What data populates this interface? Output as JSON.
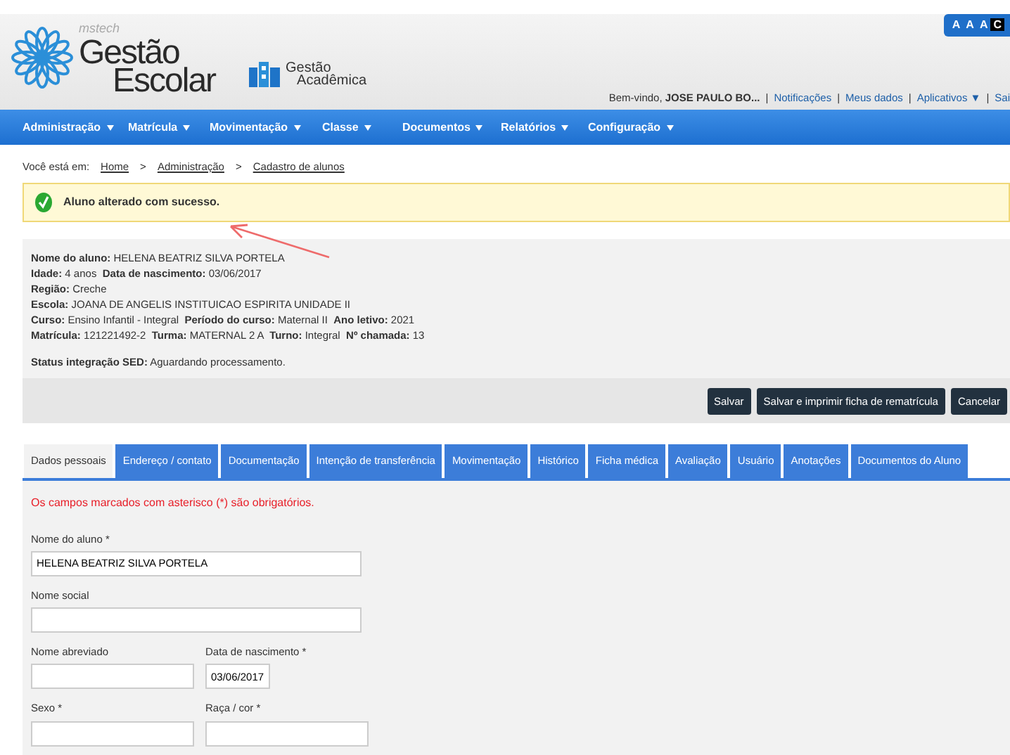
{
  "header": {
    "brand_small": "mstech",
    "brand_line1": "Gestão",
    "brand_line2": "Escolar",
    "module_line1": "Gestão",
    "module_line2": "Acadêmica",
    "font_buttons": [
      {
        "label": "A",
        "selected": false
      },
      {
        "label": "A",
        "selected": false
      },
      {
        "label": "A",
        "selected": false
      },
      {
        "label": "C",
        "selected": true
      }
    ],
    "welcome": "Bem-vindo, **JOSE PAULO BO...**",
    "separators": [
      "|",
      "|",
      "|",
      "|"
    ],
    "links": [
      "Notificações",
      "Meus dados",
      "Aplicativos ▼",
      "Sai"
    ]
  },
  "menu": [
    "Administração",
    "Matrícula",
    "Movimentação",
    "Classe",
    "Documentos",
    "Relatórios",
    "Configuração"
  ],
  "breadcrumb": {
    "label": "Você está em:",
    "separators": [
      ">",
      ">"
    ],
    "items": [
      "Home",
      "Administração",
      "Cadastro de alunos"
    ]
  },
  "alert": {
    "text": "Aluno alterado com sucesso."
  },
  "student": {
    "lines": [
      "**Nome do aluno:** HELENA BEATRIZ SILVA PORTELA",
      "**Idade:** 4 anos  **Data de nascimento:** 03/06/2017",
      "**Região:** Creche",
      "**Escola:** JOANA DE ANGELIS INSTITUICAO ESPIRITA UNIDADE II",
      "**Curso:** Ensino Infantil - Integral  **Período do curso:** Maternal II  **Ano letivo:** 2021",
      "**Matrícula:** 121221492-2  **Turma:** MATERNAL 2 A  **Turno:** Integral  **Nº chamada:** 13"
    ],
    "status": "**Status integração SED:** Aguardando processamento."
  },
  "actions": [
    "Salvar",
    "Salvar e imprimir ficha de rematrícula",
    "Cancelar"
  ],
  "tabs": [
    {
      "label": "Dados pessoais",
      "selected": true
    },
    {
      "label": "Endereço / contato",
      "selected": false
    },
    {
      "label": "Documentação",
      "selected": false
    },
    {
      "label": "Intenção de transferência",
      "selected": false
    },
    {
      "label": "Movimentação",
      "selected": false
    },
    {
      "label": "Histórico",
      "selected": false
    },
    {
      "label": "Ficha médica",
      "selected": false
    },
    {
      "label": "Avaliação",
      "selected": false
    },
    {
      "label": "Usuário",
      "selected": false
    },
    {
      "label": "Anotações",
      "selected": false
    },
    {
      "label": "Documentos do Aluno",
      "selected": false
    }
  ],
  "required_note": "Os campos marcados com asterisco (*) são obrigatórios.",
  "form_rows": [
    [
      {
        "label": "Nome do aluno *",
        "value": "HELENA BEATRIZ SILVA PORTELA",
        "kind": "wide"
      }
    ],
    [
      {
        "label": "Nome social",
        "kind": "wide"
      }
    ],
    [
      {
        "label": "Nome abreviado",
        "kind": "half"
      },
      {
        "label": "Data de nascimento *",
        "value": "03/06/2017",
        "kind": "date"
      }
    ],
    [
      {
        "label": "Sexo *",
        "kind": "half"
      },
      {
        "label": "Raça / cor *",
        "kind": "half"
      }
    ]
  ]
}
